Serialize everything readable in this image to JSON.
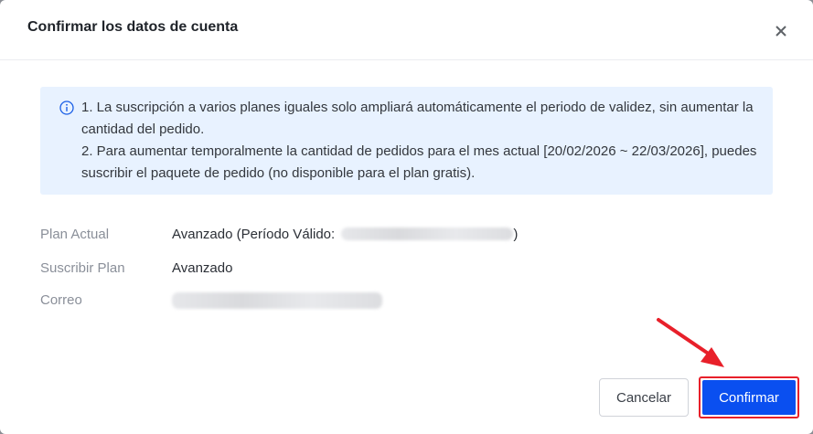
{
  "dialog": {
    "title": "Confirmar los datos de cuenta",
    "close_icon": "close-icon"
  },
  "notice": {
    "icon": "info-circle-icon",
    "lines": [
      "1. La suscripción a varios planes iguales solo ampliará automáticamente el periodo de validez, sin aumentar la cantidad del pedido.",
      "2. Para aumentar temporalmente la cantidad de pedidos para el mes actual [20/02/2026 ~ 22/03/2026], puedes suscribir el paquete de pedido (no disponible para el plan gratis)."
    ]
  },
  "details": {
    "current_plan_label": "Plan Actual",
    "current_plan_value_prefix": "Avanzado (Período Válido:",
    "current_plan_value_suffix": ")",
    "subscribe_plan_label": "Suscribir Plan",
    "subscribe_plan_value": "Avanzado",
    "email_label": "Correo"
  },
  "footer": {
    "cancel_label": "Cancelar",
    "confirm_label": "Confirmar"
  },
  "colors": {
    "primary": "#0a4ff0",
    "highlight": "#e8202a",
    "notice_bg": "#e8f2ff"
  }
}
